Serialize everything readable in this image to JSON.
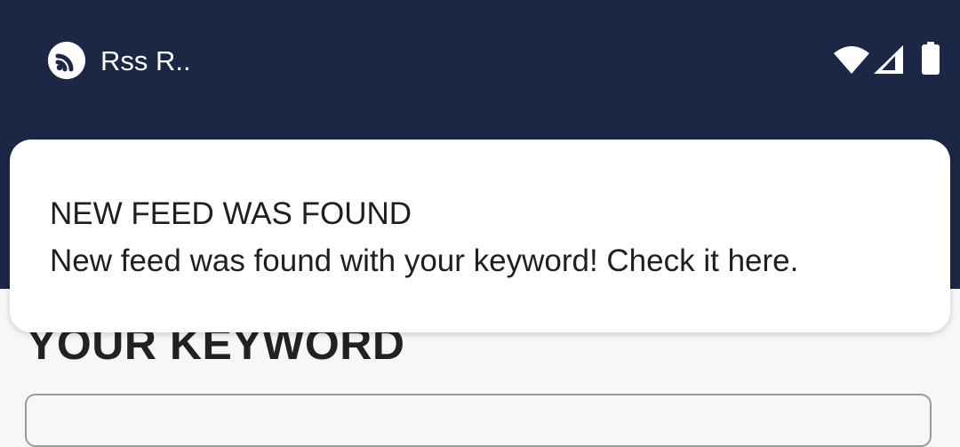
{
  "status_bar": {
    "app_name": "Rss R..",
    "app_icon": "rss-icon",
    "wifi_icon": "wifi-icon",
    "signal_icon": "cellular-signal-icon",
    "battery_icon": "battery-icon",
    "background_color": "#1b2744"
  },
  "notification": {
    "title": "NEW FEED WAS FOUND",
    "body": "New feed was found with your keyword! Check it here."
  },
  "main": {
    "section_title": "YOUR KEYWORD",
    "keyword_input_value": ""
  }
}
